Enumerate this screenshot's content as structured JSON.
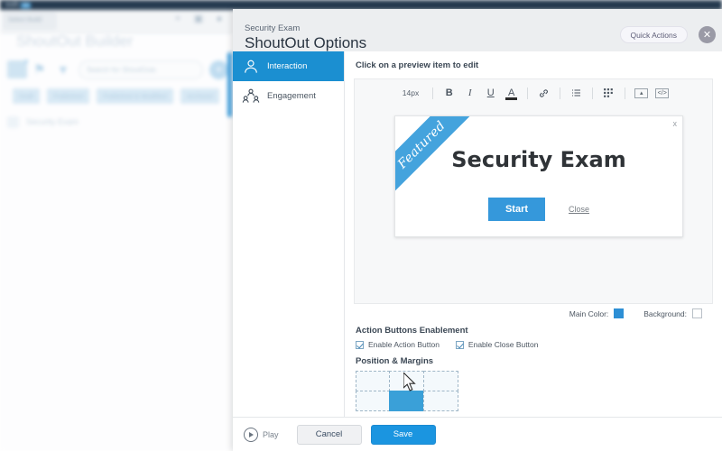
{
  "background": {
    "logo_text": "walk",
    "logo_badge": "me",
    "tab_label": "Select Build",
    "page_title": "ShoutOut Builder",
    "search_placeholder": "Search for ShoutOuts",
    "chips": [
      "Draft",
      "Published",
      "Published & Modified",
      "Archived"
    ],
    "list_item": "Security Exam",
    "icons": [
      "share-icon",
      "book-icon",
      "user-icon"
    ]
  },
  "modal": {
    "subtitle": "Security Exam",
    "title": "ShoutOut Options",
    "quick_actions_label": "Quick Actions",
    "close_label": "✕",
    "sidebar": [
      {
        "label": "Interaction",
        "icon": "person-icon",
        "active": true
      },
      {
        "label": "Engagement",
        "icon": "group-icon",
        "active": false
      }
    ],
    "hint": "Click on a preview item to edit",
    "toolbar": {
      "font_size": "14px",
      "bold": "B",
      "italic": "I",
      "underline": "U",
      "text_color": "A",
      "link": "ὑ7",
      "list": "list-icon",
      "table": "table-icon",
      "image": "image-icon",
      "code": "code-icon"
    },
    "preview": {
      "ribbon": "Featured",
      "title": "Security Exam",
      "start_label": "Start",
      "close_label": "Close",
      "dismiss_label": "x"
    },
    "colors": {
      "main_color_label": "Main Color:",
      "main_color_value": "#2d8fd5",
      "background_label": "Background:",
      "background_value": "#ffffff"
    },
    "action_buttons": {
      "section_title": "Action Buttons Enablement",
      "items": [
        {
          "label": "Enable Action Button",
          "checked": true
        },
        {
          "label": "Enable Close Button",
          "checked": true
        }
      ]
    },
    "position": {
      "section_title": "Position & Margins",
      "columns": 3,
      "rows": 2,
      "selected_cell": "bottom-center"
    },
    "footer": {
      "play_label": "Play",
      "cancel_label": "Cancel",
      "save_label": "Save"
    }
  }
}
